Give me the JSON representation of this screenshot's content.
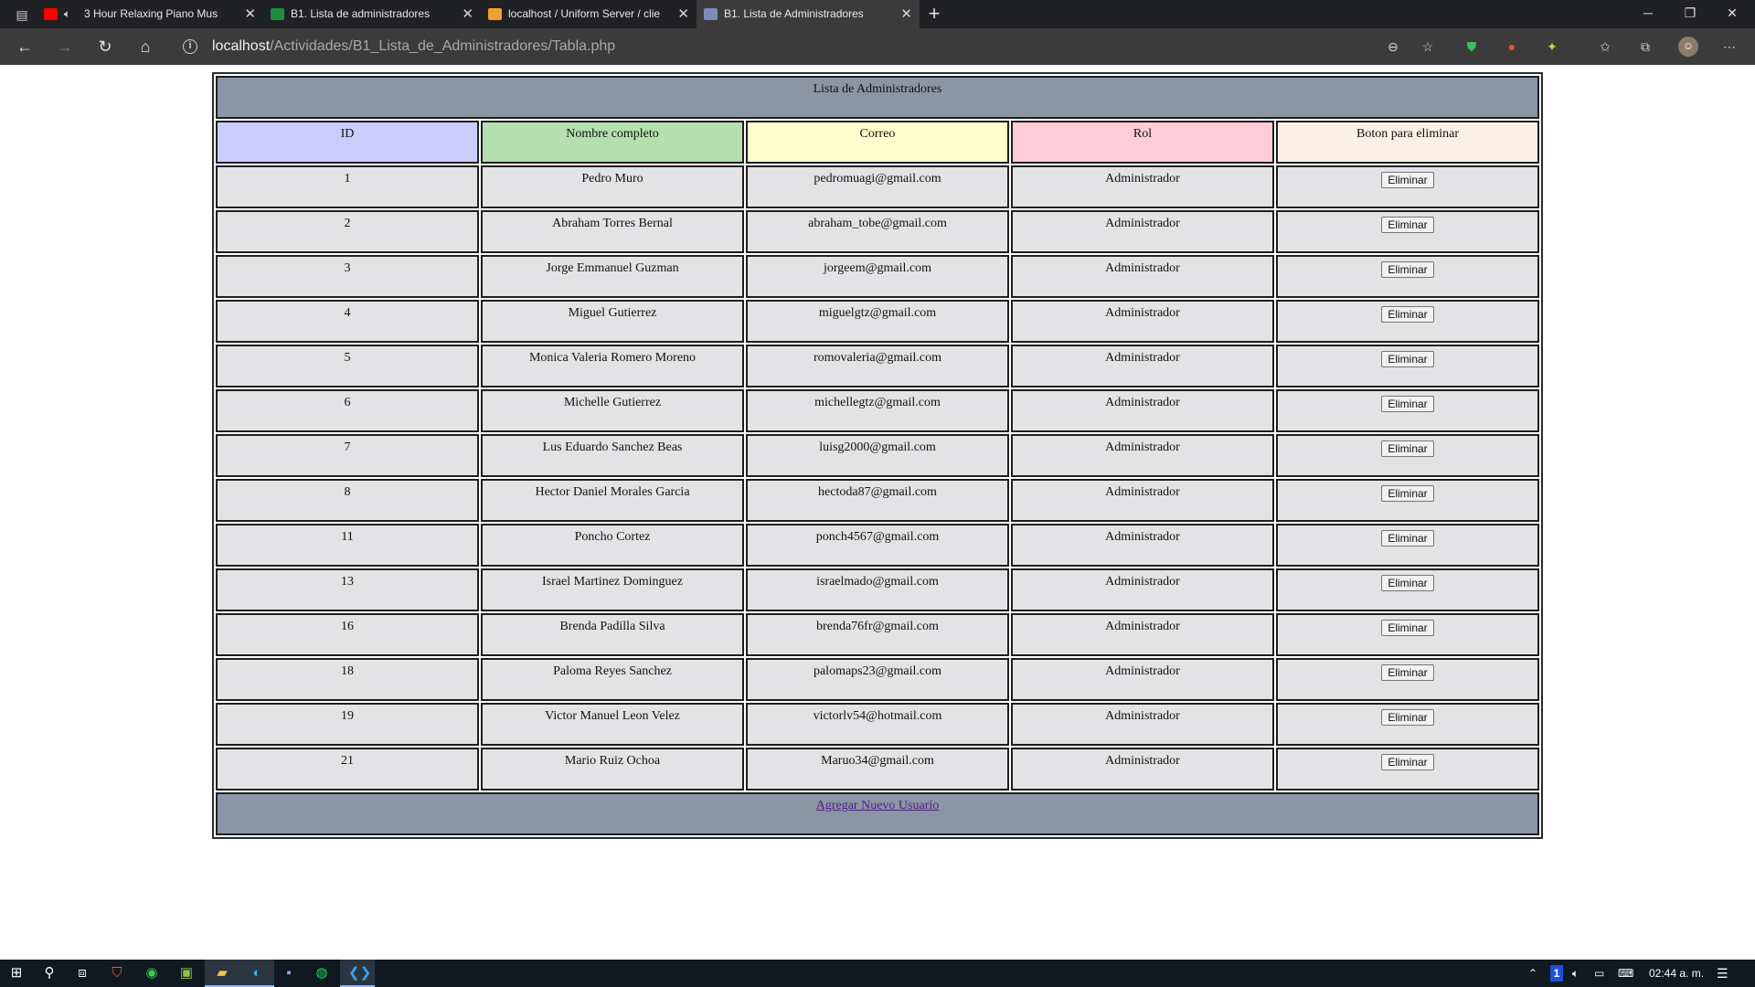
{
  "browser": {
    "tabs": [
      {
        "title": "3 Hour Relaxing Piano Mus",
        "favicon_color": "#ff0000",
        "audio": true,
        "active": false
      },
      {
        "title": "B1. Lista de administradores",
        "favicon_color": "#1e8e3e",
        "audio": false,
        "active": false
      },
      {
        "title": "localhost / Uniform Server / clie",
        "favicon_color": "#f0a030",
        "audio": false,
        "active": false
      },
      {
        "title": "B1. Lista de Administradores",
        "favicon_color": "#7b8bb8",
        "audio": false,
        "active": true
      }
    ],
    "url_host": "localhost",
    "url_path": "/Actividades/B1_Lista_de_Administradores/Tabla.php",
    "accent_color": "#8ab4f8"
  },
  "table": {
    "caption": "Lista de Administradores",
    "headers": [
      {
        "label": "ID",
        "color": "#ccccff"
      },
      {
        "label": "Nombre completo",
        "color": "#b3e0ad"
      },
      {
        "label": "Correo",
        "color": "#ffffcc"
      },
      {
        "label": "Rol",
        "color": "#ffccd9"
      },
      {
        "label": "Boton para eliminar",
        "color": "#fcefe3"
      }
    ],
    "button_label": "Eliminar",
    "rows": [
      {
        "id": "1",
        "name": "Pedro Muro",
        "email": "pedromuagi@gmail.com",
        "role": "Administrador"
      },
      {
        "id": "2",
        "name": "Abraham Torres Bernal",
        "email": "abraham_tobe@gmail.com",
        "role": "Administrador"
      },
      {
        "id": "3",
        "name": "Jorge Emmanuel Guzman",
        "email": "jorgeem@gmail.com",
        "role": "Administrador"
      },
      {
        "id": "4",
        "name": "Miguel Gutierrez",
        "email": "miguelgtz@gmail.com",
        "role": "Administrador"
      },
      {
        "id": "5",
        "name": "Monica Valeria Romero Moreno",
        "email": "romovaleria@gmail.com",
        "role": "Administrador"
      },
      {
        "id": "6",
        "name": "Michelle Gutierrez",
        "email": "michellegtz@gmail.com",
        "role": "Administrador"
      },
      {
        "id": "7",
        "name": "Lus Eduardo Sanchez Beas",
        "email": "luisg2000@gmail.com",
        "role": "Administrador"
      },
      {
        "id": "8",
        "name": "Hector Daniel Morales Garcia",
        "email": "hectoda87@gmail.com",
        "role": "Administrador"
      },
      {
        "id": "11",
        "name": "Poncho Cortez",
        "email": "ponch4567@gmail.com",
        "role": "Administrador"
      },
      {
        "id": "13",
        "name": "Israel Martinez Dominguez",
        "email": "israelmado@gmail.com",
        "role": "Administrador"
      },
      {
        "id": "16",
        "name": "Brenda Padilla Silva",
        "email": "brenda76fr@gmail.com",
        "role": "Administrador"
      },
      {
        "id": "18",
        "name": "Paloma Reyes Sanchez",
        "email": "palomaps23@gmail.com",
        "role": "Administrador"
      },
      {
        "id": "19",
        "name": "Victor Manuel Leon Velez",
        "email": "victorlv54@hotmail.com",
        "role": "Administrador"
      },
      {
        "id": "21",
        "name": "Mario Ruiz Ochoa",
        "email": "Maruo34@gmail.com",
        "role": "Administrador"
      }
    ],
    "footer_link": "Agregar Nuevo Usuario"
  },
  "taskbar": {
    "clock": "02:44 a. m.",
    "tray_badge": "1"
  }
}
